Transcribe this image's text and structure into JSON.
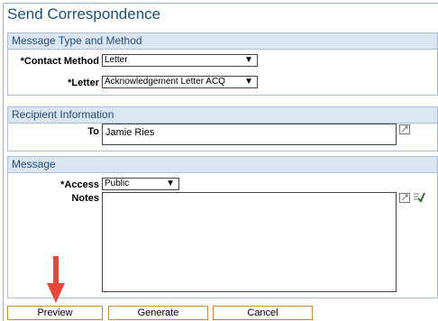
{
  "page": {
    "title": "Send Correspondence"
  },
  "message_type": {
    "header": "Message Type and Method",
    "contact_method_label": "*Contact Method",
    "contact_method_value": "Letter",
    "letter_label": "*Letter",
    "letter_value": "Acknowledgement Letter ACQ"
  },
  "recipient": {
    "header": "Recipient Information",
    "to_label": "To",
    "to_value": "Jamie Ries"
  },
  "message": {
    "header": "Message",
    "access_label": "*Access",
    "access_value": "Public",
    "notes_label": "Notes",
    "notes_value": ""
  },
  "buttons": {
    "preview": "Preview",
    "generate": "Generate",
    "cancel": "Cancel"
  },
  "colors": {
    "title": "#1f4e79",
    "section_header_bg": "#dbe6f2",
    "arrow": "#e8463a",
    "button_border": "#c98a3a"
  }
}
